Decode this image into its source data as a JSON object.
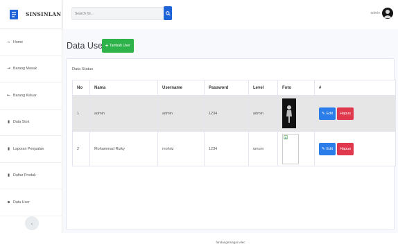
{
  "brand": {
    "name": "SINSINLAN"
  },
  "sidebar": {
    "items": [
      {
        "label": "Home",
        "icon": "home-icon"
      },
      {
        "label": "Barang Masuk",
        "icon": "arrow-in-icon"
      },
      {
        "label": "Barang Keluar",
        "icon": "arrow-out-icon"
      },
      {
        "label": "Data Stok",
        "icon": "bar-chart-icon"
      },
      {
        "label": "Laporan Penjualan",
        "icon": "bar-chart-icon"
      },
      {
        "label": "Daftar Produk",
        "icon": "bar-chart-icon"
      },
      {
        "label": "Data User",
        "icon": "users-icon"
      }
    ],
    "toggle": "‹"
  },
  "topbar": {
    "search_placeholder": "Search for...",
    "user_name": "admin"
  },
  "page": {
    "title": "Data User",
    "add_button": "Tambah User"
  },
  "card": {
    "header": "Data Status",
    "columns": [
      "No",
      "Nama",
      "Username",
      "Password",
      "Level",
      "Foto",
      "#"
    ],
    "rows": [
      {
        "no": "1",
        "nama": "admin",
        "username": "admin",
        "password": "1234",
        "level": "admin",
        "foto": "photo"
      },
      {
        "no": "2",
        "nama": "Mohammad Rizky",
        "username": "mohriz",
        "password": "1234",
        "level": "umum",
        "foto": "broken-image"
      }
    ],
    "edit_label": "Edit",
    "delete_label": "Hapus"
  },
  "footer": {
    "text": "fandangernagaz.elec"
  },
  "colors": {
    "primary": "#1e63d8",
    "success": "#2db34a",
    "danger": "#e0394e",
    "info": "#2b7de9",
    "selected_row": "#e6e6e6"
  }
}
